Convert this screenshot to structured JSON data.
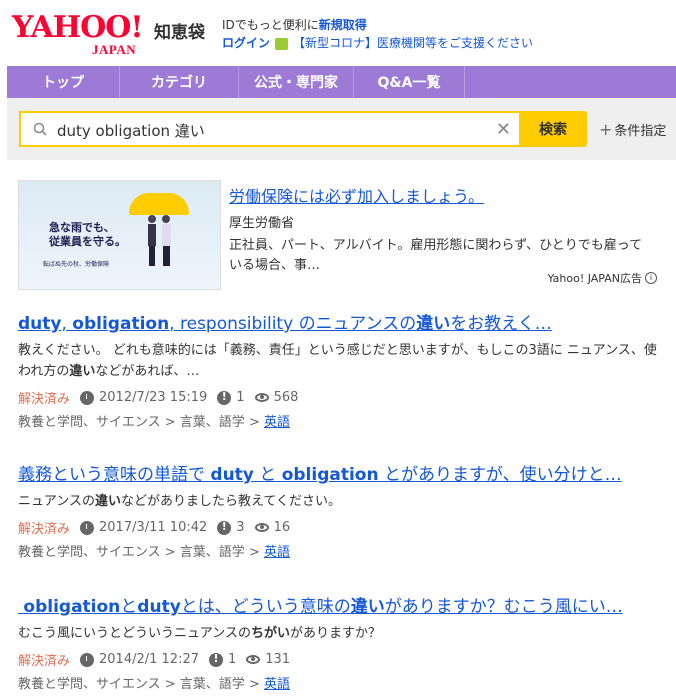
{
  "header": {
    "logo_main": "YAHOO!",
    "logo_sub": "JAPAN",
    "service": "知恵袋",
    "notice_prefix": "IDでもっと便利に",
    "notice_link": "新規取得",
    "login": "ログイン",
    "covid_notice": "【新型コロナ】医療機関等をご支援ください"
  },
  "nav": [
    "トップ",
    "カテゴリ",
    "公式・専門家",
    "Q&A一覧"
  ],
  "search": {
    "value": "duty obligation 違い",
    "button": "検索",
    "conditions": "条件指定"
  },
  "ad": {
    "image_slogan_1": "急な雨でも、",
    "image_slogan_2": "従業員を守る。",
    "image_small": "転ばぬ先の杖、労働保険",
    "title": "労働保険には必ず加入しましょう。",
    "sponsor": "厚生労働省",
    "description": "正社員、パート、アルバイト。雇用形態に関わらず、ひとりでも雇っている場合、事…",
    "label": "Yahoo! JAPAN広告"
  },
  "results": [
    {
      "title_html": "<b>duty</b>, <b>obligation</b>, responsibility のニュアンスの<b>違い</b>をお教えく…",
      "snippet_html": "教えください。 どれも意味的には「義務、責任」という感じだと思いますが、もしこの3語に ニュアンス、使われ方の<b>違い</b>などがあれば、…",
      "status": "解決済み",
      "date": "2012/7/23 15:19",
      "answers": "1",
      "views": "568",
      "crumb_1": "教養と学問、サイエンス",
      "crumb_2": "言葉、語学",
      "crumb_3": "英語"
    },
    {
      "title_html": "義務という意味の単語で <b>duty</b> と <b>obligation</b> とがありますが、使い分けと…",
      "snippet_html": "ニュアンスの<b>違い</b>などがありましたら教えてください。",
      "status": "解決済み",
      "date": "2017/3/11 10:42",
      "answers": "3",
      "views": "16",
      "crumb_1": "教養と学問、サイエンス",
      "crumb_2": "言葉、語学",
      "crumb_3": "英語"
    },
    {
      "title_html": "&nbsp;<b>obligation</b>と<b>duty</b>とは、どういう意味の<b>違い</b>がありますか？むこう風にい…",
      "snippet_html": "むこう風にいうとどういうニュアンスの<b>ちがい</b>がありますか？",
      "status": "解決済み",
      "date": "2014/2/1 12:27",
      "answers": "1",
      "views": "131",
      "crumb_1": "教養と学問、サイエンス",
      "crumb_2": "言葉、語学",
      "crumb_3": "英語"
    }
  ]
}
